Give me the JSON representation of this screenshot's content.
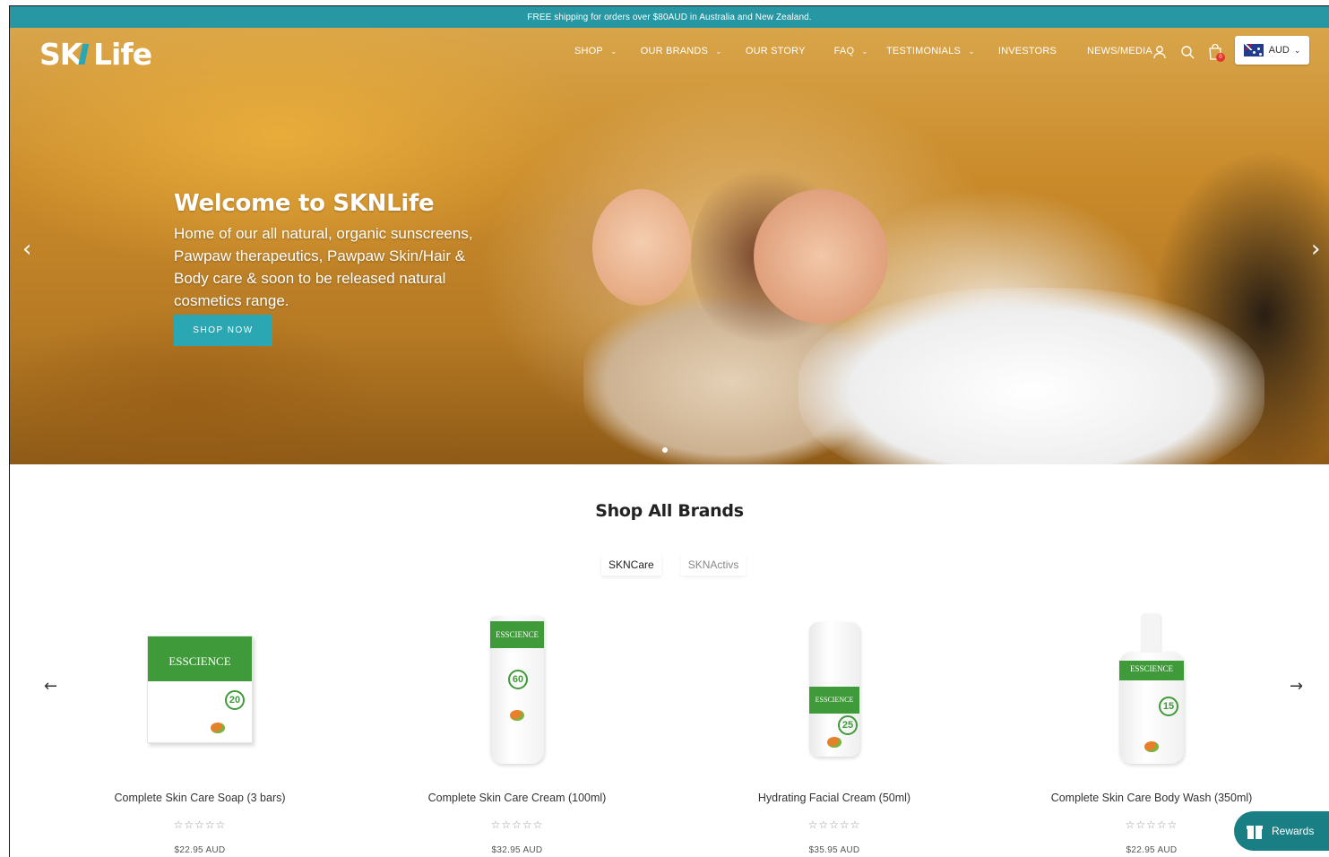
{
  "announcement": "FREE shipping for orders over $80AUD in Australia and New Zealand.",
  "logo": "SKNLife",
  "nav": {
    "items": [
      {
        "label": "SHOP"
      },
      {
        "label": "OUR BRANDS"
      },
      {
        "label": "OUR STORY"
      },
      {
        "label": "FAQ"
      },
      {
        "label": "TESTIMONIALS"
      },
      {
        "label": "INVESTORS"
      },
      {
        "label": "NEWS/MEDIA"
      }
    ],
    "cart_count": "0",
    "currency": "AUD"
  },
  "hero": {
    "title": "Welcome to SKNLife",
    "subtitle": "Home of our all natural, organic sunscreens, Pawpaw therapeutics, Pawpaw Skin/Hair & Body care & soon to be released natural cosmetics range.",
    "cta": "SHOP NOW"
  },
  "shop": {
    "title": "Shop All Brands",
    "tabs": [
      {
        "label": "SKNCare"
      },
      {
        "label": "SKNActivs"
      }
    ],
    "products": [
      {
        "name": "Complete Skin Care Soap (3 bars)",
        "price": "$22.95 AUD",
        "stars": "☆☆☆☆☆",
        "brand": "ESSCIENCE",
        "spf": "20"
      },
      {
        "name": "Complete Skin Care Cream (100ml)",
        "price": "$32.95 AUD",
        "stars": "☆☆☆☆☆",
        "brand": "ESSCIENCE",
        "spf": "60"
      },
      {
        "name": "Hydrating Facial Cream (50ml)",
        "price": "$35.95 AUD",
        "stars": "☆☆☆☆☆",
        "brand": "ESSCIENCE",
        "spf": "25"
      },
      {
        "name": "Complete Skin Care Body Wash (350ml)",
        "price": "$22.95 AUD",
        "stars": "☆☆☆☆☆",
        "brand": "ESSCIENCE",
        "spf": "15"
      }
    ]
  },
  "rewards": "Rewards",
  "colors": {
    "accent": "#2797a3",
    "button": "#2ba6b3",
    "rewards": "#1a7f84",
    "brand_green": "#3f9a3a"
  }
}
